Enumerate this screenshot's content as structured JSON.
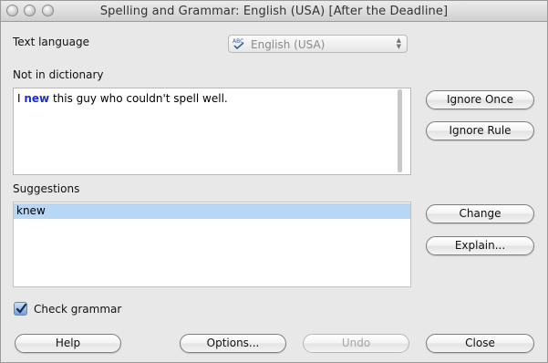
{
  "window": {
    "title": "Spelling and Grammar: English (USA) [After the Deadline]"
  },
  "language": {
    "label": "Text language",
    "selected": "English (USA)",
    "icon": "abc-spellcheck-icon"
  },
  "not_in_dictionary": {
    "label": "Not in dictionary",
    "text_before": "I ",
    "error_word": "new",
    "text_after": " this guy who couldn't spell well.",
    "error_color": "#1a2fd8"
  },
  "suggestions": {
    "label": "Suggestions",
    "items": [
      "knew"
    ],
    "selected_index": 0
  },
  "side_buttons": {
    "ignore_once": "Ignore Once",
    "ignore_rule": "Ignore Rule",
    "change": "Change",
    "explain": "Explain..."
  },
  "check_grammar": {
    "label": "Check grammar",
    "checked": true
  },
  "bottom_buttons": {
    "help": "Help",
    "options": "Options...",
    "undo": "Undo",
    "close": "Close"
  }
}
